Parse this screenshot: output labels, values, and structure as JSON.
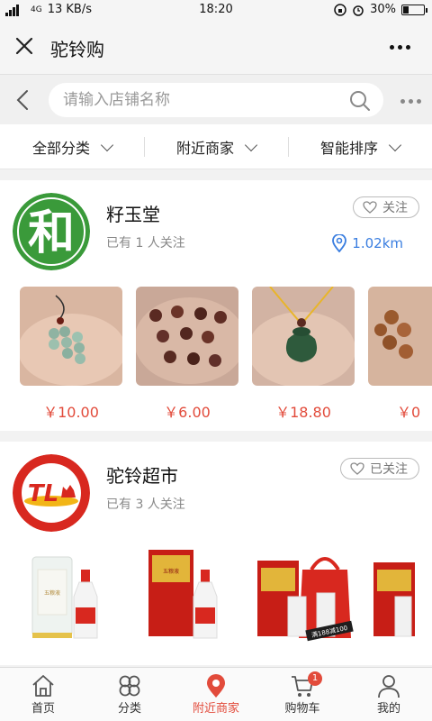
{
  "status_bar": {
    "signal": "4G",
    "speed": "13 KB/s",
    "time": "18:20",
    "battery": "30%",
    "battery_level": 0.3
  },
  "header": {
    "title": "驼铃购"
  },
  "search": {
    "placeholder": "请输入店铺名称"
  },
  "filters": [
    {
      "label": "全部分类"
    },
    {
      "label": "附近商家"
    },
    {
      "label": "智能排序"
    }
  ],
  "stores": [
    {
      "name": "籽玉堂",
      "logo_text": "和",
      "followers": "已有 1 人关注",
      "follow_label": "关注",
      "distance": "1.02km",
      "products": [
        {
          "price": "￥10.00"
        },
        {
          "price": "￥6.00"
        },
        {
          "price": "￥18.80"
        },
        {
          "price": "￥0"
        }
      ]
    },
    {
      "name": "驼铃超市",
      "logo_text": "TL",
      "followers": "已有 3 人关注",
      "follow_label": "已关注",
      "product_texts": [
        "五粮液",
        "五粮液",
        "满188减100"
      ]
    }
  ],
  "bottom_nav": [
    {
      "label": "首页",
      "icon": "home-icon"
    },
    {
      "label": "分类",
      "icon": "category-icon"
    },
    {
      "label": "附近商家",
      "icon": "location-icon"
    },
    {
      "label": "购物车",
      "icon": "cart-icon",
      "badge": "1"
    },
    {
      "label": "我的",
      "icon": "user-icon"
    }
  ],
  "colors": {
    "accent": "#e24b3b",
    "link": "#3a7ee0",
    "logo_green": "#3a9a3a",
    "logo_red": "#d8281f"
  }
}
